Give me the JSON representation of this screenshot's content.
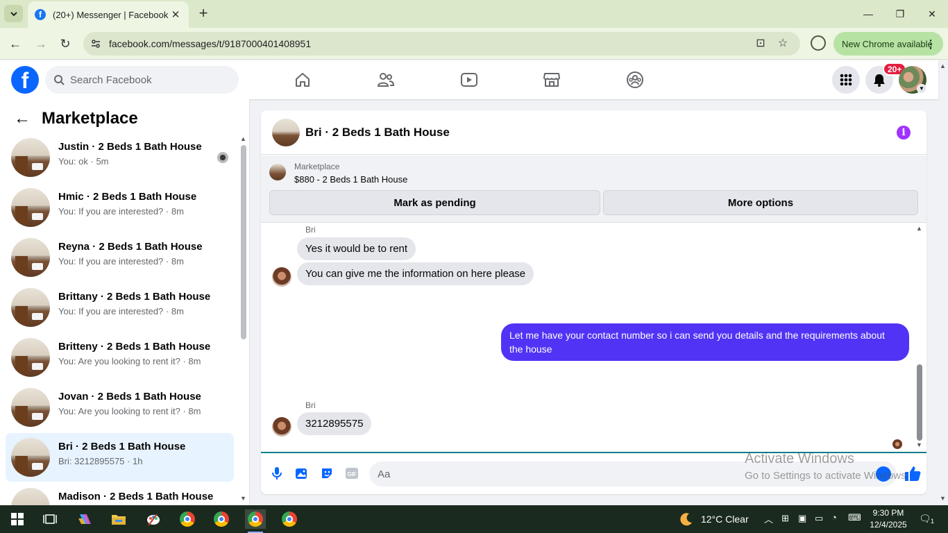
{
  "browser": {
    "tab_title": "(20+) Messenger | Facebook",
    "url": "facebook.com/messages/t/9187000401408951",
    "update_chip": "New Chrome available"
  },
  "facebook": {
    "search_placeholder": "Search Facebook",
    "notification_badge": "20+"
  },
  "marketplace": {
    "title": "Marketplace",
    "conversations": [
      {
        "name": "Justin · 2 Beds 1 Bath House",
        "preview": "You: ok · 5m",
        "active": false
      },
      {
        "name": "Hmic · 2 Beds 1 Bath House",
        "preview": "You: If you are interested? · 8m",
        "active": false
      },
      {
        "name": "Reyna · 2 Beds 1 Bath House",
        "preview": "You: If you are interested? · 8m",
        "active": false
      },
      {
        "name": "Brittany · 2 Beds 1 Bath House",
        "preview": "You: If you are interested? · 8m",
        "active": false
      },
      {
        "name": "Britteny · 2 Beds 1 Bath House",
        "preview": "You: Are you looking to rent it? · 8m",
        "active": false
      },
      {
        "name": "Jovan · 2 Beds 1 Bath House",
        "preview": "You: Are you looking to rent it? · 8m",
        "active": false
      },
      {
        "name": "Bri · 2 Beds 1 Bath House",
        "preview": "Bri: 3212895575 · 1h",
        "active": true
      },
      {
        "name": "Madison · 2 Beds 1 Bath House",
        "preview": "",
        "active": false
      }
    ]
  },
  "chat": {
    "title": "Bri · 2 Beds 1 Bath House",
    "listing_label": "Marketplace",
    "listing_price": "$880 - 2 Beds 1 Bath House",
    "mark_pending": "Mark as pending",
    "more_options": "More options",
    "messages": {
      "sender1": "Bri",
      "m1": "Yes it would be to rent",
      "m2": "You can give me the information on here please",
      "m3": "Let me have your contact number so i can send you details and the requirements about the house",
      "sender2": "Bri",
      "m4": "3212895575"
    },
    "input_placeholder": "Aa"
  },
  "watermark": {
    "line1": "Activate Windows",
    "line2": "Go to Settings to activate Windows."
  },
  "taskbar": {
    "weather": "12°C  Clear",
    "time": "9:30 PM",
    "date": "12/4/2025",
    "notifications": "1"
  },
  "colors": {
    "fb_blue": "#0866ff",
    "outgoing_bubble": "#5133f5",
    "badge_red": "#e41e3f"
  }
}
